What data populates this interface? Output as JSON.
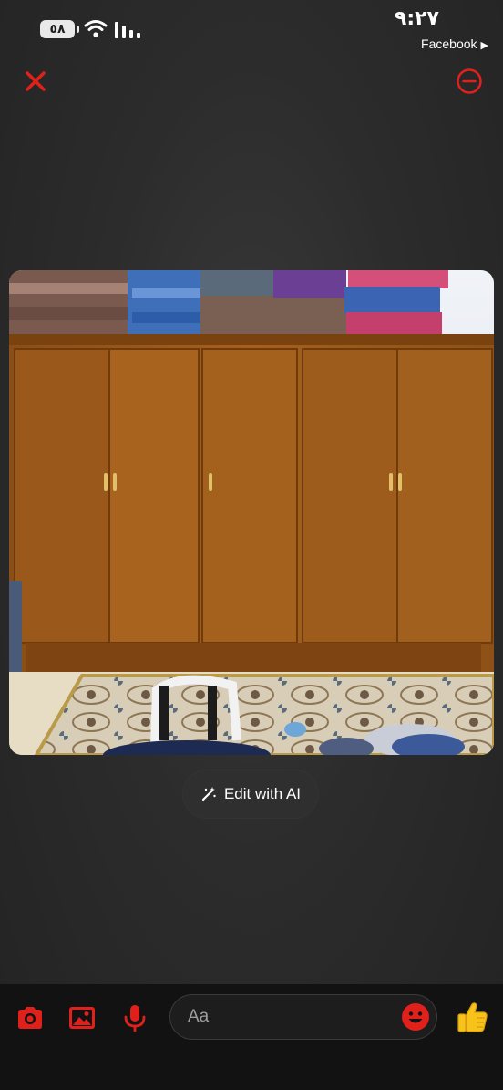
{
  "status_bar": {
    "time": "٩:٢٧",
    "battery": "٥٨",
    "back_app": "Facebook",
    "back_arrow": "▶"
  },
  "viewer": {
    "edit_ai_label": "Edit with AI"
  },
  "composer": {
    "input_placeholder": "Aa"
  },
  "icons": {
    "close": "close-icon",
    "more": "more-options-icon",
    "camera": "camera-icon",
    "gallery": "gallery-icon",
    "mic": "microphone-icon",
    "emoji": "emoji-icon",
    "like": "thumbs-up-icon",
    "wand": "magic-wand-icon"
  },
  "colors": {
    "accent_red": "#e0211b",
    "background": "#2c2c2c",
    "composer_bg": "#121212"
  }
}
